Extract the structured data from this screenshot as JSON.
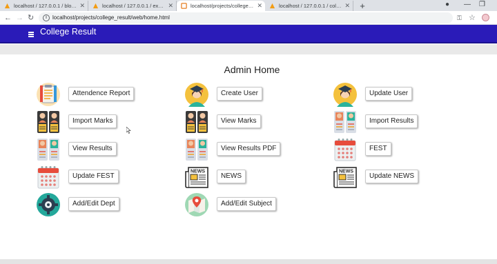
{
  "browser": {
    "tabs": [
      {
        "label": "localhost / 127.0.0.1 / blood_ma",
        "active": false
      },
      {
        "label": "localhost / 127.0.0.1 / exam / an",
        "active": false
      },
      {
        "label": "localhost/projects/college_result",
        "active": true
      },
      {
        "label": "localhost / 127.0.0.1 / college_re",
        "active": false
      }
    ],
    "new_tab": "+",
    "url": "localhost/projects/college_result/web/home.html"
  },
  "app": {
    "title": "College Result",
    "page_title": "Admin Home"
  },
  "items": [
    {
      "label": "Attendence Report",
      "icon": "report-icon"
    },
    {
      "label": "Create User",
      "icon": "graduate-icon"
    },
    {
      "label": "Update User",
      "icon": "graduate-icon"
    },
    {
      "label": "Import Marks",
      "icon": "students-icon"
    },
    {
      "label": "View Marks",
      "icon": "students-icon"
    },
    {
      "label": "Import Results",
      "icon": "students-light-icon"
    },
    {
      "label": "View Results",
      "icon": "students-light-icon"
    },
    {
      "label": "View Results PDF",
      "icon": "students-light-icon"
    },
    {
      "label": "FEST",
      "icon": "calendar-icon"
    },
    {
      "label": "Update FEST",
      "icon": "calendar-icon"
    },
    {
      "label": "NEWS",
      "icon": "newspaper-icon"
    },
    {
      "label": "Update NEWS",
      "icon": "newspaper-icon"
    },
    {
      "label": "Add/Edit Dept",
      "icon": "settings-icon"
    },
    {
      "label": "Add/Edit Subject",
      "icon": "map-icon"
    }
  ],
  "colors": {
    "header": "#2a1bb8",
    "page_bg": "#ffffff"
  }
}
